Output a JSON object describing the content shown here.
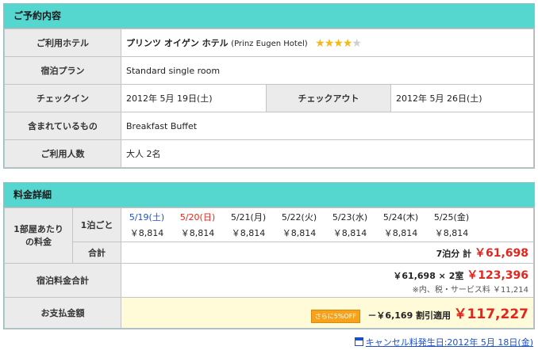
{
  "reservation": {
    "header": "ご予約内容",
    "hotel_label": "ご利用ホテル",
    "hotel_name": "プリンツ オイゲン ホテル",
    "hotel_name_en": "(Prinz Eugen Hotel)",
    "stars": 4,
    "stars_max": 5,
    "plan_label": "宿泊プラン",
    "plan_value": "Standard single room",
    "checkin_label": "チェックイン",
    "checkin_value": "2012年 5月 19日(土)",
    "checkout_label": "チェックアウト",
    "checkout_value": "2012年 5月 26日(土)",
    "included_label": "含まれているもの",
    "included_value": "Breakfast Buffet",
    "guests_label": "ご利用人数",
    "guests_value": "大人 2名"
  },
  "pricing": {
    "header": "料金詳細",
    "per_room_label": "1部屋あたりの料金",
    "per_night_label": "1泊ごと",
    "days": [
      {
        "date": "5/19(土)",
        "price": "￥8,814",
        "color": "blue"
      },
      {
        "date": "5/20(日)",
        "price": "￥8,814",
        "color": "red"
      },
      {
        "date": "5/21(月)",
        "price": "￥8,814",
        "color": "normal"
      },
      {
        "date": "5/22(火)",
        "price": "￥8,814",
        "color": "normal"
      },
      {
        "date": "5/23(水)",
        "price": "￥8,814",
        "color": "normal"
      },
      {
        "date": "5/24(木)",
        "price": "￥8,814",
        "color": "normal"
      },
      {
        "date": "5/25(金)",
        "price": "￥8,814",
        "color": "normal"
      }
    ],
    "subtotal_label": "合計",
    "subtotal_prefix": "7泊分 計",
    "subtotal_value": "￥61,698",
    "stay_total_label": "宿泊料金合計",
    "stay_total_formula": "￥61,698 × 2室",
    "stay_total_value": "￥123,396",
    "tax_note": "※内、税・サービス料 ￥11,214",
    "pay_label": "お支払金額",
    "discount_badge": "さらに5%OFF",
    "discount_text": "－￥6,169 割引適用",
    "pay_value": "￥117,227"
  },
  "cancel_link": "キャンセル料発生日:2012年 5月 18日(金)"
}
